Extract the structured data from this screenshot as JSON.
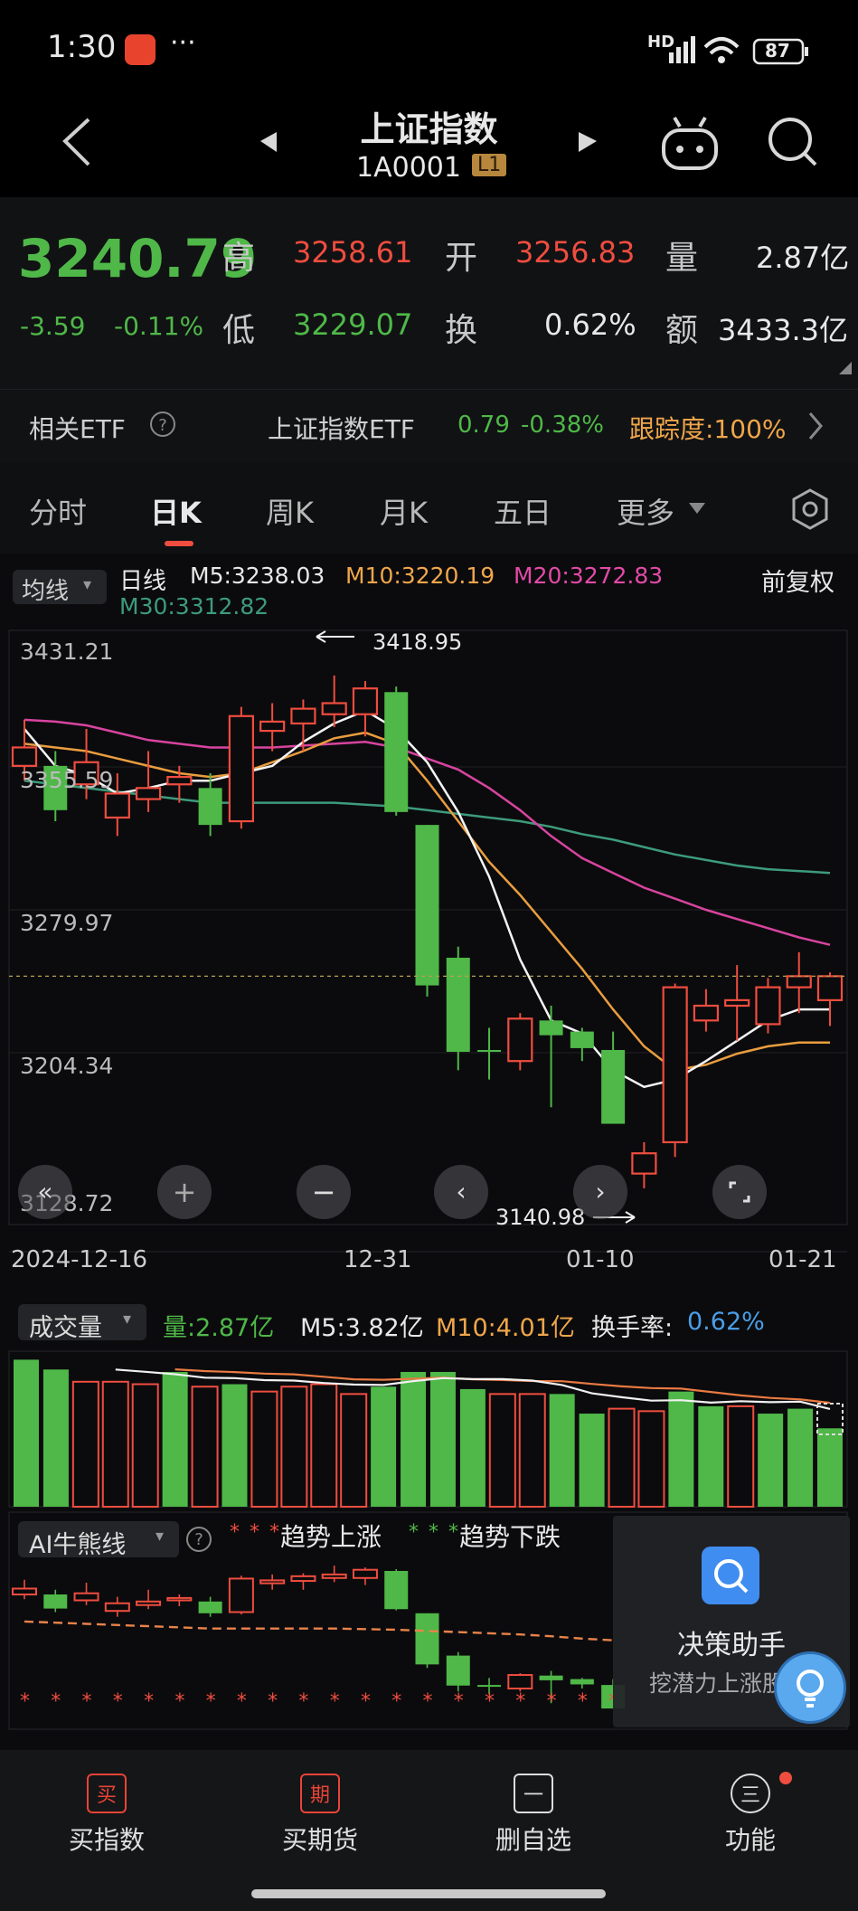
{
  "status": {
    "time": "1:30",
    "battery": "87"
  },
  "header": {
    "title": "上证指数",
    "code": "1A0001",
    "level": "L1"
  },
  "quote": {
    "price": "3240.79",
    "change": "-3.59",
    "change_pct": "-0.11%",
    "high_label": "高",
    "high": "3258.61",
    "open_label": "开",
    "open": "3256.83",
    "vol_label": "量",
    "vol": "2.87亿",
    "low_label": "低",
    "low": "3229.07",
    "turn_label": "换",
    "turn": "0.62%",
    "amt_label": "额",
    "amt": "3433.3亿"
  },
  "etf": {
    "label": "相关ETF",
    "name": "上证指数ETF",
    "price": "0.79",
    "pct": "-0.38%",
    "track": "跟踪度:100%"
  },
  "tabs": [
    "分时",
    "日K",
    "周K",
    "月K",
    "五日",
    "更多"
  ],
  "active_tab": 1,
  "ma": {
    "dropdown": "均线",
    "period": "日线",
    "m5": "M5:3238.03",
    "m10": "M10:3220.19",
    "m20": "M20:3272.83",
    "m30": "M30:3312.82",
    "adjust": "前复权"
  },
  "price_axis": [
    "3431.21",
    "3355.59",
    "3279.97",
    "3204.34",
    "3128.72"
  ],
  "annotations": {
    "high": "3418.95",
    "low": "3140.98"
  },
  "date_axis": [
    "2024-12-16",
    "12-31",
    "01-10",
    "01-21"
  ],
  "volume": {
    "dropdown": "成交量",
    "qty": "量:2.87亿",
    "m5": "M5:3.82亿",
    "m10": "M10:4.01亿",
    "turn_label": "换手率:",
    "turn": "0.62%"
  },
  "ai": {
    "dropdown": "AI牛熊线",
    "up": "趋势上涨",
    "down": "趋势下跌"
  },
  "assistant": {
    "title": "决策助手",
    "subtitle": "挖潜力上涨股"
  },
  "nav": [
    {
      "icon": "买",
      "label": "买指数"
    },
    {
      "icon": "期",
      "label": "买期货"
    },
    {
      "icon": "一",
      "label": "删自选"
    },
    {
      "icon": "三",
      "label": "功能"
    }
  ],
  "chart_data": {
    "type": "candlestick",
    "ylim": [
      3128.72,
      3431.21
    ],
    "candles": [
      {
        "o": 3370,
        "c": 3380,
        "h": 3395,
        "l": 3362
      },
      {
        "o": 3370,
        "c": 3346,
        "h": 3378,
        "l": 3340
      },
      {
        "o": 3360,
        "c": 3372,
        "h": 3390,
        "l": 3352
      },
      {
        "o": 3342,
        "c": 3355,
        "h": 3366,
        "l": 3332
      },
      {
        "o": 3352,
        "c": 3358,
        "h": 3378,
        "l": 3345
      },
      {
        "o": 3360,
        "c": 3364,
        "h": 3370,
        "l": 3350
      },
      {
        "o": 3358,
        "c": 3338,
        "h": 3366,
        "l": 3332
      },
      {
        "o": 3340,
        "c": 3397,
        "h": 3402,
        "l": 3336
      },
      {
        "o": 3389,
        "c": 3394,
        "h": 3404,
        "l": 3378
      },
      {
        "o": 3393,
        "c": 3401,
        "h": 3406,
        "l": 3378
      },
      {
        "o": 3398,
        "c": 3404,
        "h": 3419,
        "l": 3391
      },
      {
        "o": 3398,
        "c": 3412,
        "h": 3416,
        "l": 3386
      },
      {
        "o": 3410,
        "c": 3345,
        "h": 3413,
        "l": 3343
      },
      {
        "o": 3338,
        "c": 3251,
        "h": 3338,
        "l": 3245
      },
      {
        "o": 3266,
        "c": 3215,
        "h": 3272,
        "l": 3205
      },
      {
        "o": 3216,
        "c": 3215,
        "h": 3228,
        "l": 3200
      },
      {
        "o": 3210,
        "c": 3233,
        "h": 3236,
        "l": 3205
      },
      {
        "o": 3232,
        "c": 3224,
        "h": 3240,
        "l": 3185
      },
      {
        "o": 3226,
        "c": 3217,
        "h": 3228,
        "l": 3210
      },
      {
        "o": 3216,
        "c": 3176,
        "h": 3226,
        "l": 3176
      },
      {
        "o": 3149,
        "c": 3160,
        "h": 3166,
        "l": 3141
      },
      {
        "o": 3166,
        "c": 3250,
        "h": 3252,
        "l": 3158
      },
      {
        "o": 3232,
        "c": 3240,
        "h": 3249,
        "l": 3226
      },
      {
        "o": 3240,
        "c": 3243,
        "h": 3262,
        "l": 3221
      },
      {
        "o": 3230,
        "c": 3250,
        "h": 3255,
        "l": 3225
      },
      {
        "o": 3250,
        "c": 3256,
        "h": 3269,
        "l": 3236
      },
      {
        "o": 3243,
        "c": 3256,
        "h": 3258,
        "l": 3229
      }
    ],
    "ma5": [
      3390,
      3370,
      3365,
      3355,
      3358,
      3362,
      3362,
      3366,
      3370,
      3383,
      3393,
      3400,
      3390,
      3372,
      3345,
      3310,
      3265,
      3232,
      3225,
      3205,
      3196,
      3200,
      3210,
      3221,
      3232,
      3238,
      3238
    ],
    "ma10": [
      3382,
      3380,
      3378,
      3374,
      3370,
      3366,
      3364,
      3366,
      3372,
      3378,
      3385,
      3388,
      3382,
      3362,
      3340,
      3318,
      3300,
      3280,
      3260,
      3238,
      3218,
      3205,
      3208,
      3214,
      3218,
      3220,
      3220
    ],
    "ma20": [
      3395,
      3394,
      3392,
      3388,
      3384,
      3382,
      3380,
      3380,
      3380,
      3381,
      3382,
      3383,
      3380,
      3374,
      3368,
      3358,
      3346,
      3332,
      3320,
      3312,
      3304,
      3298,
      3292,
      3287,
      3282,
      3277,
      3273
    ],
    "ma30": [
      3362,
      3360,
      3358,
      3356,
      3354,
      3352,
      3350,
      3350,
      3350,
      3350,
      3350,
      3349,
      3348,
      3346,
      3344,
      3342,
      3340,
      3337,
      3333,
      3330,
      3326,
      3322,
      3319,
      3316,
      3314,
      3313,
      3312
    ],
    "volume": [
      6.0,
      5.6,
      5.1,
      5.1,
      5.0,
      5.5,
      4.9,
      5.0,
      4.7,
      4.9,
      5.0,
      4.6,
      4.9,
      5.5,
      5.5,
      4.8,
      4.6,
      4.6,
      4.6,
      3.8,
      4.0,
      3.9,
      4.7,
      4.1,
      4.1,
      3.8,
      4.0,
      3.2
    ],
    "vol_dir": [
      "g",
      "g",
      "r",
      "r",
      "r",
      "g",
      "r",
      "g",
      "r",
      "r",
      "r",
      "r",
      "g",
      "g",
      "g",
      "g",
      "r",
      "r",
      "g",
      "g",
      "r",
      "r",
      "g",
      "g",
      "r",
      "g",
      "g",
      "g"
    ]
  }
}
